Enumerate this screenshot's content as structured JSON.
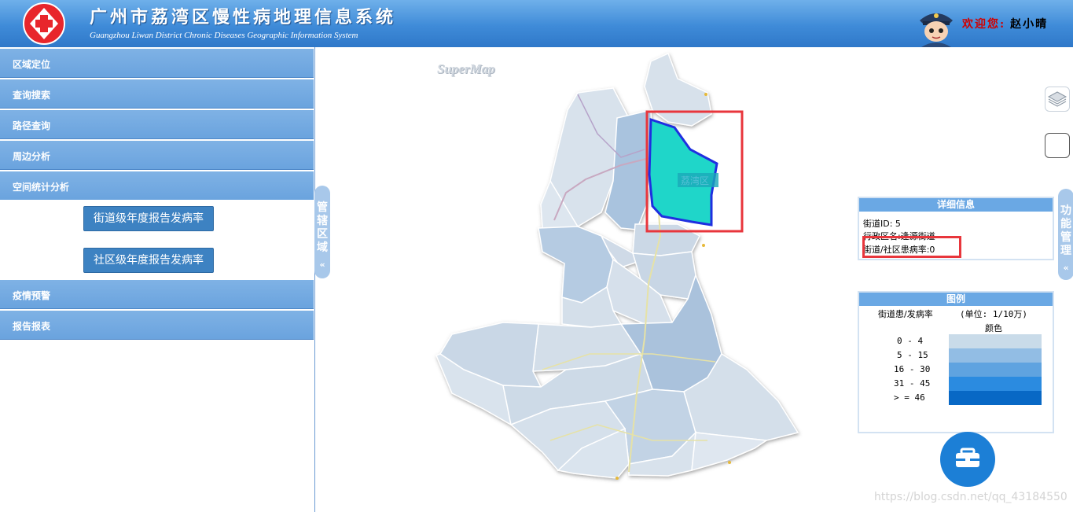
{
  "header": {
    "title_cn": "广州市荔湾区慢性病地理信息系统",
    "title_en": "Guangzhou Liwan District Chronic Diseases Geographic Information System",
    "welcome_label": "欢迎您:",
    "user_name": "赵小晴",
    "logo_icon": "medical-cross-icon",
    "avatar_icon": "police-cartoon-avatar"
  },
  "sidebar": {
    "menu": [
      {
        "label": "区域定位"
      },
      {
        "label": "查询搜索"
      },
      {
        "label": "路径查询"
      },
      {
        "label": "周边分析"
      },
      {
        "label": "空间统计分析"
      }
    ],
    "submenu_buttons": [
      {
        "label": "街道级年度报告发病率"
      },
      {
        "label": "社区级年度报告发病率"
      }
    ],
    "menu_after": [
      {
        "label": "疫情预警"
      },
      {
        "label": "报告报表"
      }
    ]
  },
  "tabs": {
    "left_tab": "管辖区域",
    "right_tab": "功能管理",
    "chevron": "«"
  },
  "map": {
    "provider_logo": "SuperMap",
    "selected_label": "荔湾区",
    "highlight_color": "#1fd6c9"
  },
  "detail_panel": {
    "title": "详细信息",
    "rows": [
      "街道ID: 5",
      "行政区名:逢源街道",
      "街道/社区患病率:0"
    ]
  },
  "legend": {
    "title": "图例",
    "header_left": "街道患/发病率",
    "header_right": "(单位: 1/10万)",
    "color_header": "颜色",
    "items": [
      {
        "range": "0 - 4",
        "color": "#c9dbe9"
      },
      {
        "range": "5 - 15",
        "color": "#92bde4"
      },
      {
        "range": "16 - 30",
        "color": "#5fa3e0"
      },
      {
        "range": "31 - 45",
        "color": "#2b8be0"
      },
      {
        "range": "> = 46",
        "color": "#0868c5"
      }
    ]
  },
  "toolbar": {
    "layers_icon": "layers-icon",
    "fab_icon": "toolbox-icon"
  },
  "watermark": "https://blog.csdn.net/qq_43184550"
}
